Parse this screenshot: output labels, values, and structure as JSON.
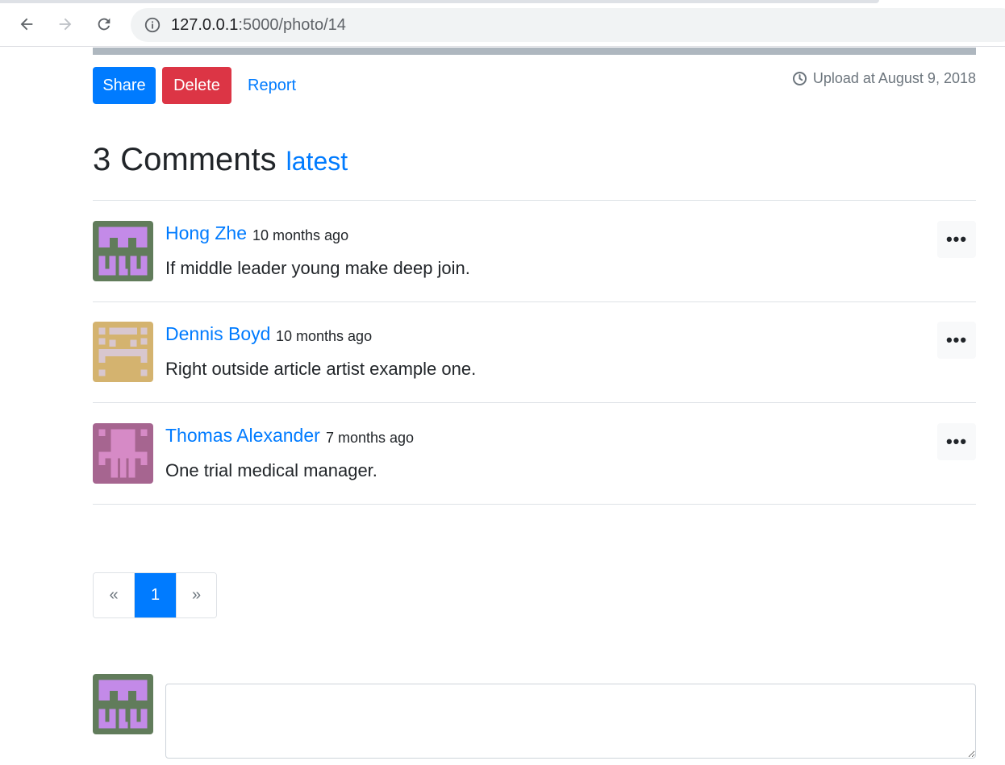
{
  "browser": {
    "url_host": "127.0.0.1",
    "url_rest": ":5000/photo/14",
    "back_icon": "arrow-left-icon",
    "forward_icon": "arrow-right-icon",
    "reload_icon": "reload-icon",
    "info_icon": "info-icon"
  },
  "photo": {
    "actions": {
      "share_label": "Share",
      "delete_label": "Delete",
      "report_label": "Report"
    },
    "upload_text": "Upload at August 9, 2018",
    "upload_icon": "clock-icon"
  },
  "comments": {
    "count": "3",
    "title_word": "Comments",
    "sort_label": "latest",
    "items": [
      {
        "author": "Hong Zhe",
        "time": "10 months ago",
        "body": "If middle leader young make deep join.",
        "avatar_bg": "#617c5b",
        "avatar_fg": "#c38ae8",
        "more_label": "•••"
      },
      {
        "author": "Dennis Boyd",
        "time": "10 months ago",
        "body": "Right outside article artist example one.",
        "avatar_bg": "#d4b36f",
        "avatar_fg": "#d8c7cf",
        "more_label": "•••"
      },
      {
        "author": "Thomas Alexander",
        "time": "7 months ago",
        "body": "One trial medical manager.",
        "avatar_bg": "#a66590",
        "avatar_fg": "#d68ac6",
        "more_label": "•••"
      }
    ]
  },
  "pagination": {
    "prev_label": "«",
    "current_label": "1",
    "next_label": "»"
  },
  "new_comment": {
    "avatar_bg": "#617c5b",
    "avatar_fg": "#c38ae8",
    "value": "",
    "placeholder": ""
  },
  "colors": {
    "primary": "#007bff",
    "danger": "#dc3545",
    "muted": "#6c757d"
  }
}
